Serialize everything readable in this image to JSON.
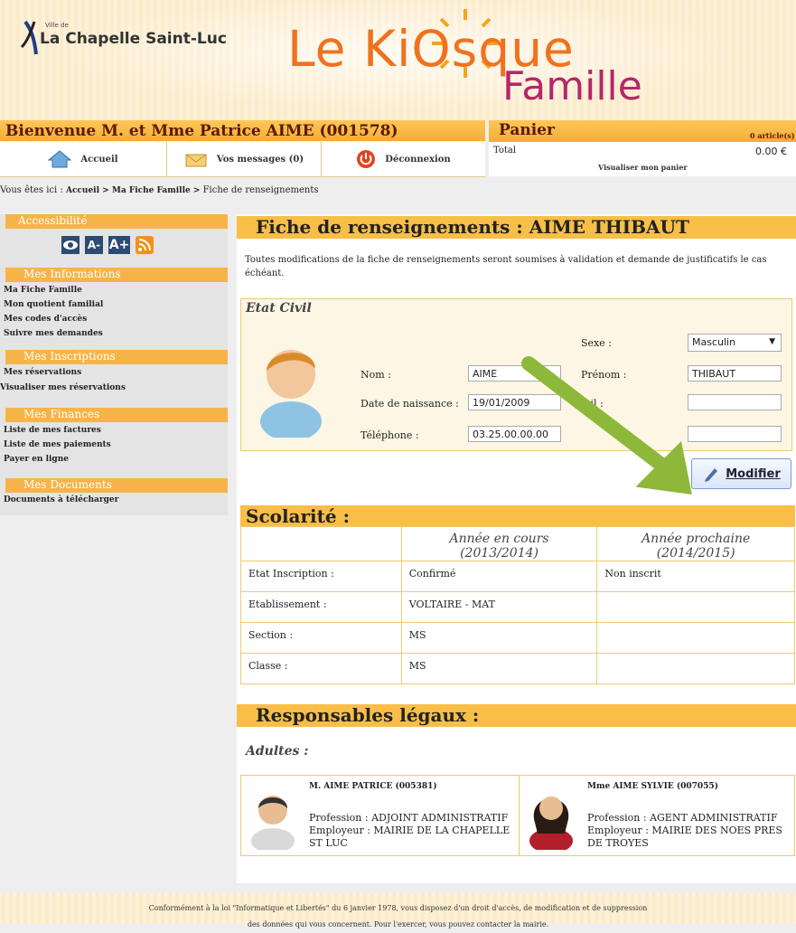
{
  "header": {
    "city_small": "Ville de",
    "city_name": "La Chapelle Saint-Luc",
    "brand_part1": "Le KiOsque",
    "brand_part2": "Famille"
  },
  "welcome": {
    "text": "Bienvenue M. et Mme Patrice AIME (001578)"
  },
  "nav": [
    {
      "label": "Accueil",
      "icon": "home-icon"
    },
    {
      "label": "Vos messages (0)",
      "icon": "envelope-icon"
    },
    {
      "label": "Déconnexion",
      "icon": "power-icon"
    }
  ],
  "panier": {
    "title": "Panier",
    "count": "0 article(s)",
    "total_label": "Total",
    "total_value": "0.00 €",
    "link": "Visualiser mon panier"
  },
  "breadcrumb": {
    "prefix": "Vous êtes ici : ",
    "items": [
      "Accueil >",
      "Ma Fiche Famille >",
      "Fiche de renseignements"
    ]
  },
  "sidebar": {
    "accessibility": "Accessibilité",
    "access_icons": [
      "eye-icon",
      "text-smaller-icon",
      "text-larger-icon",
      "rss-icon"
    ],
    "access_text": [
      "A-",
      "A+"
    ],
    "groups": [
      {
        "title": "Mes Informations",
        "links": [
          "Ma Fiche Famille",
          "Mon quotient familial",
          "Mes codes d'accès",
          "Suivre mes demandes"
        ]
      },
      {
        "title": "Mes Inscriptions",
        "links": [
          "Mes réservations",
          "Visualiser mes réservations"
        ]
      },
      {
        "title": "Mes Finances",
        "links": [
          "Liste de mes factures",
          "Liste de mes paiements",
          "Payer en ligne"
        ]
      },
      {
        "title": "Mes Documents",
        "links": [
          "Documents à télécharger"
        ]
      }
    ]
  },
  "page": {
    "title": "Fiche de renseignements : AIME THIBAUT",
    "info": "Toutes modifications de la fiche de renseignements seront soumises à validation et demande de justificatifs le cas échéant."
  },
  "etat_civil": {
    "label": "Etat Civil",
    "sexe_label": "Sexe :",
    "sexe_value": "Masculin",
    "nom_label": "Nom :",
    "nom_value": "AIME",
    "prenom_label": "Prénom :",
    "prenom_value": "THIBAUT",
    "dob_label": "Date de naissance :",
    "dob_value": "19/01/2009",
    "field3_label": "...il :",
    "tel_label": "Téléphone :",
    "tel_value": "03.25.00.00.00",
    "modifier": "Modifier"
  },
  "scolarite": {
    "title": "Scolarité :",
    "headers": [
      "",
      "Année en cours (2013/2014)",
      "Année prochaine (2014/2015)"
    ],
    "rows": [
      [
        "Etat Inscription :",
        "Confirmé",
        "Non inscrit"
      ],
      [
        "Etablissement :",
        "VOLTAIRE - MAT",
        ""
      ],
      [
        "Section :",
        "MS",
        ""
      ],
      [
        "Classe :",
        "MS",
        ""
      ]
    ]
  },
  "responsables": {
    "title": "Responsables légaux :",
    "adultes": "Adultes :",
    "people": [
      {
        "name": "M. AIME PATRICE (005381)",
        "profession": "Profession : ADJOINT ADMINISTRATIF",
        "employeur": "Employeur : MAIRIE DE LA CHAPELLE ST LUC"
      },
      {
        "name": "Mme AIME SYLVIE (007055)",
        "profession": "Profession : AGENT ADMINISTRATIF",
        "employeur": "Employeur : MAIRIE DES NOES PRES DE TROYES"
      }
    ]
  },
  "footer": {
    "line1": "Conformément à la loi \"Informatique et Libertés\" du 6 janvier 1978, vous disposez d'un droit d'accès, de modification et de suppression",
    "line2": "des données qui vous concernent. Pour l'exercer, vous pouvez contacter la mairie."
  },
  "colors": {
    "accent": "#f8be48",
    "brand_orange": "#f0721e",
    "brand_purple": "#b4276a",
    "arrow": "#8db83a"
  }
}
